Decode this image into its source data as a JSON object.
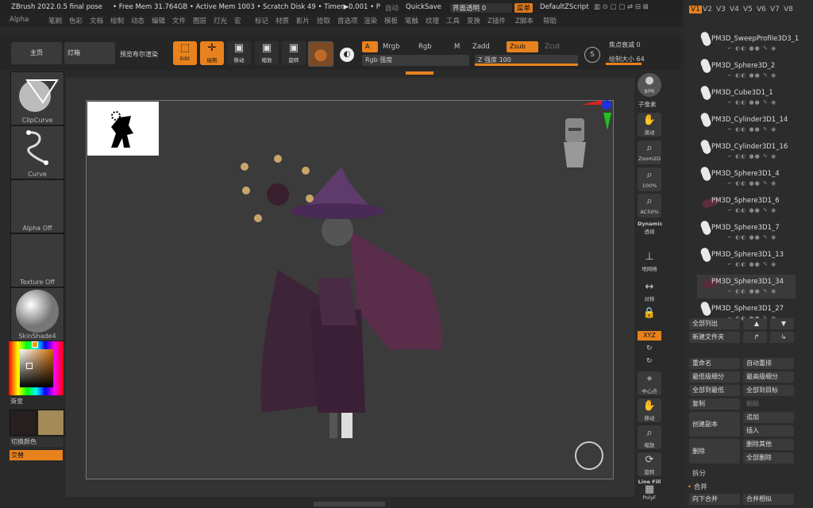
{
  "titlebar": {
    "app": "ZBrush 2022.0.5 final pose",
    "mem": "• Free Mem 31.764GB • Active Mem 1003 • Scratch Disk 49 • Timer▶0.001 • P",
    "auto": "自动",
    "quicksave": "QuickSave",
    "transparency": "界面透明 0",
    "menu": "菜单",
    "script": "DefaultZScript"
  },
  "menus": [
    "Alpha",
    "笔刷",
    "色彩",
    "文档",
    "绘制",
    "动态",
    "编辑",
    "文件",
    "图层",
    "灯光",
    "宏",
    "标记",
    "材质",
    "影片",
    "拾取",
    "首选项",
    "渲染",
    "模板",
    "笔触",
    "纹理",
    "工具",
    "变换",
    "Z插件",
    "Z脚本",
    "帮助"
  ],
  "toolbar": {
    "home": "主页",
    "lightbox": "灯箱",
    "preview": "预览布尔渲染",
    "edit": "Edit",
    "draw": "绘制",
    "move": "移动",
    "scale": "缩放",
    "rotate": "旋转",
    "a": "A",
    "mrgb": "Mrgb",
    "rgb": "Rgb",
    "m": "M",
    "zadd": "Zadd",
    "zsub": "Zsub",
    "zcut": "Zcut",
    "rgb_intensity": "Rgb 强度",
    "z_intensity": "Z 强度 100",
    "focal_shift": "焦点衰减 0",
    "draw_size": "绘制大小 64",
    "z_intensity_level": 1.0,
    "draw_size_level": 0.64
  },
  "left_panel": {
    "clipcurve": "ClipCurve",
    "curve": "Curve",
    "alpha": "Alpha Off",
    "texture": "Texture Off",
    "material": "SkinShade4",
    "gradient": "渐变",
    "switch_color": "切换颜色",
    "alternate": "交替",
    "primary_color": "#262020",
    "secondary_color": "#a48a58"
  },
  "right_shelf": {
    "bpr": "BPR",
    "subpixel": "子像素",
    "scroll": "滚动",
    "zoom2d": "Zoom2D",
    "hundred": "100%",
    "ac50": "AC50%",
    "dynamic": "Dynamic",
    "perspective": "透视",
    "floor": "地网格",
    "local": "对称",
    "xyz": "XYZ",
    "center": "中心点",
    "move": "移动",
    "zoom": "缩放",
    "rotate": "旋转",
    "linefill": "Line Fill",
    "polyf": "PolyF"
  },
  "subtool": {
    "versions": [
      "V1",
      "V2",
      "V3",
      "V4",
      "V5",
      "V6",
      "V7",
      "V8"
    ],
    "items": [
      "PM3D_SweepProfile3D3_1",
      "PM3D_Sphere3D_2",
      "PM3D_Cube3D1_1",
      "PM3D_Cylinder3D1_14",
      "PM3D_Cylinder3D1_16",
      "PM3D_Sphere3D1_4",
      "PM3D_Sphere3D1_6",
      "PM3D_Sphere3D1_7",
      "PM3D_Sphere3D1_13",
      "PM3D_Sphere3D1_34",
      "PM3D_Sphere3D1_27"
    ],
    "list_all": "全部列出",
    "new_folder": "新建文件夹",
    "rename": "重命名",
    "auto_reorder": "自动重排",
    "lowest_res": "最低级细分",
    "highest_res": "最高级细分",
    "all_low": "全部到最低",
    "all_high": "全部到目标",
    "duplicate": "复制",
    "paste": "粘贴",
    "create_copy": "创建副本",
    "append": "追加",
    "insert": "插入",
    "delete": "删除",
    "delete_other": "删除其他",
    "delete_all": "全部删除",
    "split": "拆分",
    "merge": "合并",
    "merge_down": "向下合并",
    "merge_similar": "合并相似"
  },
  "colors": {
    "accent": "#e8821e",
    "bg": "#2a2a2a"
  }
}
